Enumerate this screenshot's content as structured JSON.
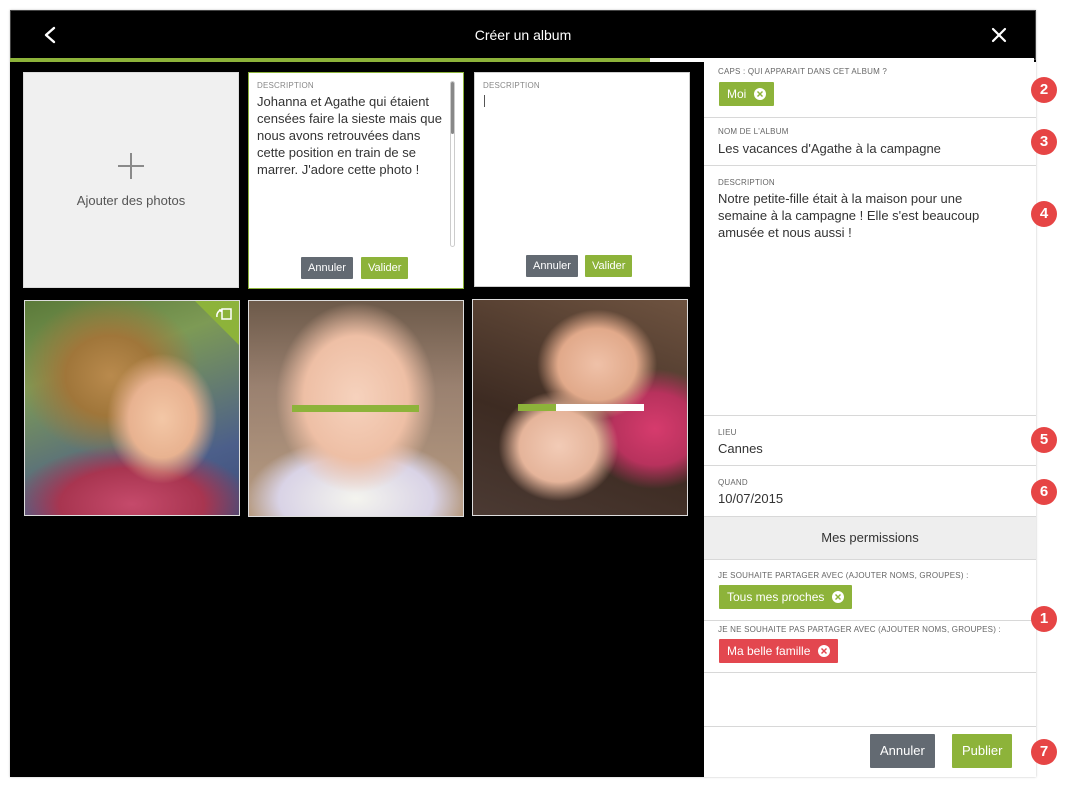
{
  "header": {
    "title": "Créer un album"
  },
  "progress": {
    "percent": 62.5
  },
  "colors": {
    "accent": "#8db33a",
    "danger": "#e3474f",
    "neutral_button": "#636a72",
    "badge": "#e64545"
  },
  "grid": {
    "add_photos_label": "Ajouter des photos",
    "card1": {
      "label": "DESCRIPTION",
      "text": "Johanna et Agathe qui étaient censées faire la sieste mais que nous avons retrouvées dans cette position en train de se marrer. J'adore cette photo !",
      "cancel": "Annuler",
      "validate": "Valider"
    },
    "card2": {
      "label": "DESCRIPTION",
      "text": "",
      "cancel": "Annuler",
      "validate": "Valider"
    },
    "photo2_upload_progress": 1.0,
    "photo3_upload_progress": 0.3
  },
  "panel": {
    "caps_label": "CAPS : QUI APPARAIT DANS CET ALBUM ?",
    "caps_tag": "Moi",
    "album_name_label": "NOM DE L'ALBUM",
    "album_name_value": "Les vacances d'Agathe à la campagne",
    "description_label": "DESCRIPTION",
    "description_value": "Notre petite-fille était à la maison pour une semaine à la campagne ! Elle s'est beaucoup amusée et nous aussi !",
    "lieu_label": "LIEU",
    "lieu_value": "Cannes",
    "quand_label": "QUAND",
    "quand_value": "10/07/2015",
    "permissions_title": "Mes permissions",
    "share_with_label": "JE SOUHAITE PARTAGER AVEC (AJOUTER NOMS, GROUPES) :",
    "share_with_tag": "Tous mes proches",
    "not_share_label": "JE NE SOUHAITE PAS PARTAGER AVEC (AJOUTER NOMS, GROUPES) :",
    "not_share_tag": "Ma belle famille",
    "cancel_button": "Annuler",
    "publish_button": "Publier"
  },
  "badges": [
    "1",
    "2",
    "3",
    "4",
    "5",
    "6",
    "7"
  ]
}
